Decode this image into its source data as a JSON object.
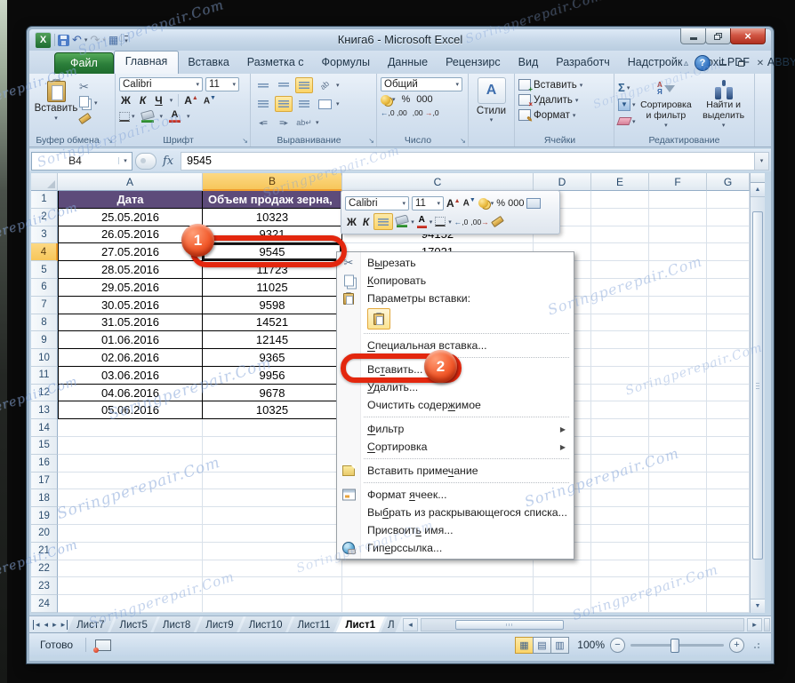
{
  "titlebar": {
    "title": "Книга6 - Microsoft Excel"
  },
  "ribbon_tabs": {
    "file": "Файл",
    "items": [
      "Главная",
      "Вставка",
      "Разметка с",
      "Формулы",
      "Данные",
      "Рецензирс",
      "Вид",
      "Разработч",
      "Надстройк",
      "Foxit PDF",
      "ABBYY PDF"
    ],
    "active": "Главная"
  },
  "ribbon": {
    "clipboard": {
      "paste": "Вставить",
      "label": "Буфер обмена"
    },
    "font": {
      "family": "Calibri",
      "size": "11",
      "bold": "Ж",
      "italic": "К",
      "underline": "Ч",
      "grow": "А",
      "label": "Шрифт"
    },
    "alignment": {
      "label": "Выравнивание"
    },
    "number": {
      "format": "Общий",
      "percent": "%",
      "thousands": "000",
      "dec_add": "←.0 .00",
      "dec_del": ".00 →.0",
      "label": "Число"
    },
    "styles": {
      "button": "Стили",
      "icon_letter": "А"
    },
    "cells": {
      "insert": "Вставить",
      "delete": "Удалить",
      "format": "Формат",
      "label": "Ячейки"
    },
    "editing": {
      "sum": "Σ",
      "sort": "Сортировка и фильтр",
      "find": "Найти и выделить",
      "label": "Редактирование"
    }
  },
  "formula_bar": {
    "name_box": "B4",
    "fx": "fx",
    "value": "9545"
  },
  "grid": {
    "columns": [
      "A",
      "B",
      "C",
      "D",
      "E",
      "F",
      "G"
    ],
    "row_count": 24,
    "selected_cell": "B4",
    "selected_column": "B",
    "selected_row": 4
  },
  "table": {
    "header": {
      "a": "Дата",
      "b": "Объем продаж зерна,"
    },
    "rows": [
      [
        "25.05.2016",
        "10323"
      ],
      [
        "26.05.2016",
        "9321"
      ],
      [
        "27.05.2016",
        "9545"
      ],
      [
        "28.05.2016",
        "11723"
      ],
      [
        "29.05.2016",
        "11025"
      ],
      [
        "30.05.2016",
        "9598"
      ],
      [
        "31.05.2016",
        "14521"
      ],
      [
        "01.06.2016",
        "12145"
      ],
      [
        "02.06.2016",
        "9365"
      ],
      [
        "03.06.2016",
        "9956"
      ],
      [
        "04.06.2016",
        "9678"
      ],
      [
        "05.06.2016",
        "10325"
      ]
    ],
    "c_fragments": [
      {
        "row": 3,
        "value": "94152"
      },
      {
        "row": 4,
        "value": "17021"
      }
    ]
  },
  "mini_toolbar": {
    "font_family": "Calibri",
    "font_size": "11",
    "bold": "Ж",
    "italic": "К",
    "grow": "А",
    "percent": "%",
    "thousands": "000"
  },
  "context_menu": {
    "items": [
      {
        "type": "item",
        "label": "Вырезать",
        "key": "ы",
        "icon": "scissors-icon"
      },
      {
        "type": "item",
        "label": "Копировать",
        "key": "К",
        "icon": "copy-icon"
      },
      {
        "type": "caption",
        "label": "Параметры вставки:",
        "icon": "paste-icon"
      },
      {
        "type": "paste-options"
      },
      {
        "type": "sep"
      },
      {
        "type": "item",
        "label": "Специальная вставка...",
        "key": "С"
      },
      {
        "type": "sep"
      },
      {
        "type": "item",
        "label": "Вставить...",
        "key": "т",
        "annotated": true
      },
      {
        "type": "item",
        "label": "Удалить...",
        "key": "У"
      },
      {
        "type": "item",
        "label": "Очистить содержимое",
        "key": "ж"
      },
      {
        "type": "sep"
      },
      {
        "type": "item",
        "label": "Фильтр",
        "key": "Ф",
        "submenu": true
      },
      {
        "type": "item",
        "label": "Сортировка",
        "key": "С",
        "submenu": true
      },
      {
        "type": "sep"
      },
      {
        "type": "item",
        "label": "Вставить примечание",
        "key": "ч",
        "icon": "note-icon"
      },
      {
        "type": "sep"
      },
      {
        "type": "item",
        "label": "Формат ячеек...",
        "key": "я",
        "icon": "format-cells-icon"
      },
      {
        "type": "item",
        "label": "Выбрать из раскрывающегося списка...",
        "key": "б"
      },
      {
        "type": "item",
        "label": "Присвоить имя...",
        "key": "ь"
      },
      {
        "type": "item",
        "label": "Гиперссылка...",
        "key": "е",
        "icon": "hyperlink-icon"
      }
    ]
  },
  "annotations": {
    "step1": "1",
    "step2": "2"
  },
  "sheet_tabs": {
    "items": [
      "Лист7",
      "Лист5",
      "Лист8",
      "Лист9",
      "Лист10",
      "Лист11",
      "Лист1",
      "Л"
    ],
    "active": "Лист1"
  },
  "status_bar": {
    "ready": "Готово",
    "zoom_level": "100%"
  },
  "watermark": {
    "text": "Soringperepair.Com"
  },
  "colors": {
    "annotation_red": "#e3270e",
    "header_purple": "#5d4b7a",
    "selection_amber": "#f7c65b",
    "file_tab_green": "#2a7d39"
  }
}
